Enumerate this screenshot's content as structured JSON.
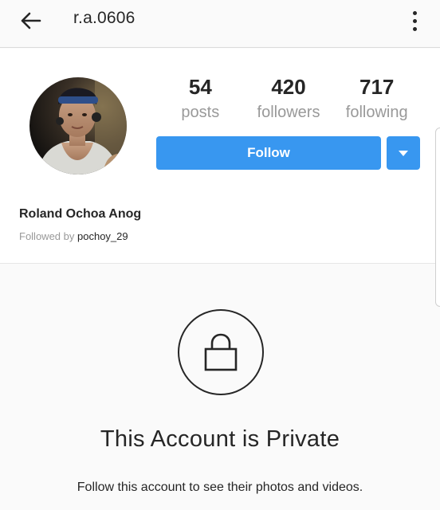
{
  "header": {
    "username": "r.a.0606",
    "back_icon": "arrow-left-icon",
    "more_icon": "more-vertical-icon"
  },
  "profile": {
    "stats": [
      {
        "value": "54",
        "label": "posts"
      },
      {
        "value": "420",
        "label": "followers"
      },
      {
        "value": "717",
        "label": "following"
      }
    ],
    "follow_label": "Follow",
    "display_name": "Roland Ochoa Anog",
    "followed_by_prefix": "Followed by",
    "followed_by_user": "pochoy_29"
  },
  "private": {
    "title": "This Account is Private",
    "subtitle": "Follow this account to see their photos and videos."
  },
  "colors": {
    "accent": "#3897f0",
    "text": "#262626",
    "muted": "#999999"
  }
}
